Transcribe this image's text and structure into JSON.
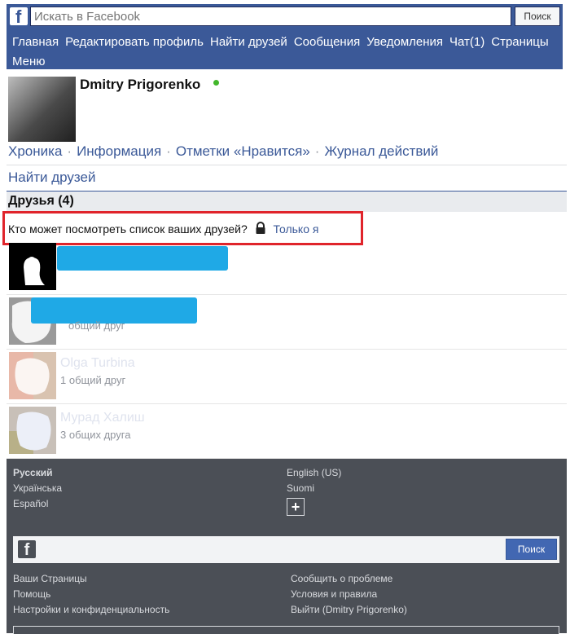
{
  "topbar": {
    "search_placeholder": "Искать в Facebook",
    "search_button": "Поиск",
    "nav": [
      "Главная",
      "Редактировать профиль",
      "Найти друзей",
      "Сообщения",
      "Уведомления",
      "Чат(1)",
      "Страницы",
      "Меню"
    ]
  },
  "profile": {
    "name": "Dmitry Prigorenko",
    "tabs": [
      "Хроника",
      "Информация",
      "Отметки «Нравится»",
      "Журнал действий"
    ]
  },
  "find_friends": "Найти друзей",
  "friends_header": "Друзья (4)",
  "privacy": {
    "question": "Кто может посмотреть список ваших друзей?",
    "value": "Только я"
  },
  "friends": [
    {
      "name": "",
      "mutual": ""
    },
    {
      "name": "",
      "mutual": "общий друг"
    },
    {
      "name": "Olga Turbina",
      "mutual": "1 общий друг"
    },
    {
      "name": "Мурад Халиш",
      "mutual": "3 общих друга"
    }
  ],
  "footer": {
    "languages_left": [
      "Русский",
      "Українська",
      "Español"
    ],
    "languages_right": [
      "English (US)",
      "Suomi"
    ],
    "search_button": "Поиск",
    "links_left": [
      "Ваши Страницы",
      "Помощь",
      "Настройки и конфиденциальность"
    ],
    "links_right": [
      "Сообщить о проблеме",
      "Условия и правила",
      "Выйти (Dmitry Prigorenko)"
    ]
  },
  "colors": {
    "brand": "#3b5998",
    "highlight": "#e0242b",
    "online": "#42b72a",
    "redaction": "#1fa9e6"
  }
}
